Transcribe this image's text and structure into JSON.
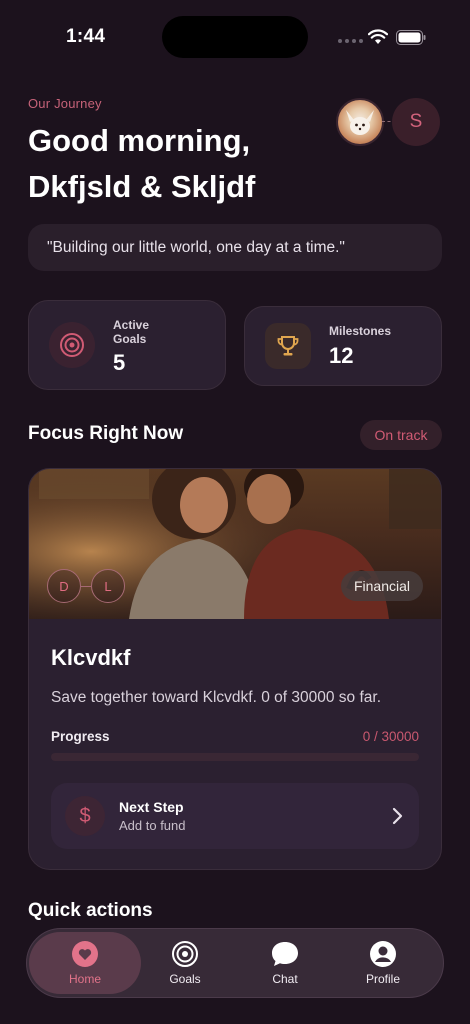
{
  "status_bar": {
    "time": "1:44"
  },
  "header": {
    "eyebrow": "Our Journey",
    "greeting": "Good morning, Dkfjsld & Skljdf",
    "partner_initial": "S"
  },
  "quote": "\"Building our little world, one day at a time.\"",
  "stats": [
    {
      "label": "Active Goals",
      "value": "5",
      "icon": "target-icon"
    },
    {
      "label": "Milestones",
      "value": "12",
      "icon": "trophy-icon"
    }
  ],
  "focus": {
    "title": "Focus Right Now",
    "status_badge": "On track",
    "card": {
      "initials": [
        "D",
        "L"
      ],
      "category": "Financial",
      "goal_name": "Klcvdkf",
      "description": "Save together toward Klcvdkf. 0 of 30000 so far.",
      "progress_label": "Progress",
      "progress_value": "0 / 30000",
      "progress_fraction": 0,
      "next_step": {
        "title": "Next Step",
        "subtitle": "Add to fund",
        "icon": "dollar-icon"
      }
    }
  },
  "quick_actions": {
    "title": "Quick actions"
  },
  "tabbar": {
    "tabs": [
      {
        "label": "Home",
        "icon": "heart-icon",
        "active": true
      },
      {
        "label": "Goals",
        "icon": "target-icon",
        "active": false
      },
      {
        "label": "Chat",
        "icon": "chat-bubble-icon",
        "active": false
      },
      {
        "label": "Profile",
        "icon": "person-icon",
        "active": false
      }
    ]
  },
  "colors": {
    "background": "#1c121d",
    "accent": "#d15b74",
    "card": "#2b2030"
  }
}
